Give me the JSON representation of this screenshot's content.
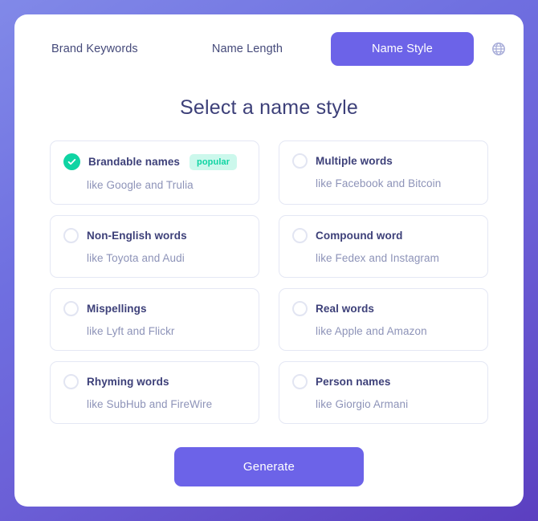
{
  "theme": {
    "accent": "#6c63e8",
    "success": "#0fd4a3",
    "badge_bg": "#ccf8ec",
    "heading_color": "#3d4079",
    "muted_text": "#8d93b8",
    "card_border": "#e4e7f4",
    "panel_bg": "#ffffff",
    "backdrop_from": "#8189e8",
    "backdrop_to": "#5b3fc0"
  },
  "tabs": [
    {
      "label": "Brand Keywords",
      "active": false,
      "name": "tab-brand-keywords"
    },
    {
      "label": "Name Length",
      "active": false,
      "name": "tab-name-length"
    },
    {
      "label": "Name Style",
      "active": true,
      "name": "tab-name-style"
    }
  ],
  "language_icon": "globe-icon",
  "heading": "Select a name style",
  "options": [
    {
      "title": "Brandable names",
      "example": "like Google and Trulia",
      "selected": true,
      "badge": "popular"
    },
    {
      "title": "Multiple words",
      "example": "like Facebook and Bitcoin",
      "selected": false,
      "badge": null
    },
    {
      "title": "Non-English words",
      "example": "like Toyota and Audi",
      "selected": false,
      "badge": null
    },
    {
      "title": "Compound word",
      "example": "like Fedex and Instagram",
      "selected": false,
      "badge": null
    },
    {
      "title": "Mispellings",
      "example": "like Lyft and Flickr",
      "selected": false,
      "badge": null
    },
    {
      "title": "Real words",
      "example": "like Apple and Amazon",
      "selected": false,
      "badge": null
    },
    {
      "title": "Rhyming words",
      "example": "like SubHub and FireWire",
      "selected": false,
      "badge": null
    },
    {
      "title": "Person names",
      "example": "like Giorgio Armani",
      "selected": false,
      "badge": null
    }
  ],
  "generate": {
    "label": "Generate"
  }
}
